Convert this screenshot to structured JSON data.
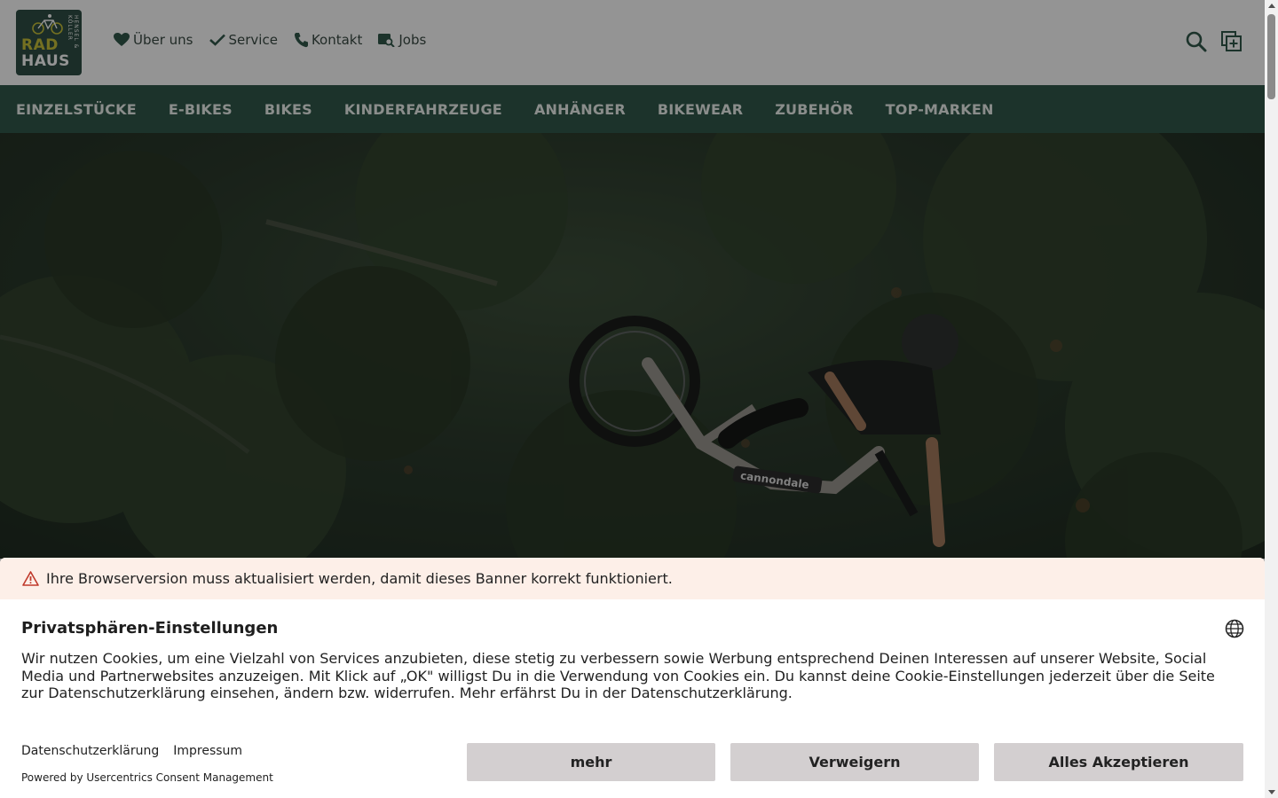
{
  "logo": {
    "line1": "RAD",
    "line2": "HAUS",
    "side_text": "HENSEL & KÖLLER"
  },
  "top_links": [
    {
      "label": "Über uns",
      "icon": "heart-icon"
    },
    {
      "label": "Service",
      "icon": "check-icon"
    },
    {
      "label": "Kontakt",
      "icon": "phone-icon"
    },
    {
      "label": "Jobs",
      "icon": "jobs-icon"
    }
  ],
  "header_icons": [
    "search-icon",
    "add-to-compare-icon"
  ],
  "main_nav": [
    "EINZELSTÜCKE",
    "E-BIKES",
    "BIKES",
    "KINDERFAHRZEUGE",
    "ANHÄNGER",
    "BIKEWEAR",
    "ZUBEHÖR",
    "TOP-MARKEN"
  ],
  "hero": {
    "frame_brand": "cannondale"
  },
  "consent": {
    "warning": "Ihre Browserversion muss aktualisiert werden, damit dieses Banner korrekt funktioniert.",
    "title": "Privatsphären-Einstellungen",
    "text": "Wir nutzen Cookies, um eine Vielzahl von Services anzubieten, diese stetig zu verbessern sowie Werbung entsprechend Deinen Interessen auf unserer Website, Social Media und Partnerwebsites anzuzeigen. Mit Klick auf „OK\" willigst Du in die Verwendung von Cookies ein. Du kannst deine Cookie-Einstellungen jederzeit über die Seite zur Datenschutzerklärung einsehen, ändern bzw. widerrufen. Mehr erfährst Du in der Datenschutzerklärung.",
    "link_privacy": "Datenschutzerklärung",
    "link_imprint": "Impressum",
    "powered_by": "Powered by Usercentrics Consent Management",
    "btn_more": "mehr",
    "btn_deny": "Verweigern",
    "btn_accept": "Alles Akzeptieren"
  },
  "colors": {
    "brand_green": "#31584b",
    "logo_yellow": "#c8c23a",
    "warning_bg": "#fdefe8",
    "button_bg": "#d3cfd0"
  }
}
